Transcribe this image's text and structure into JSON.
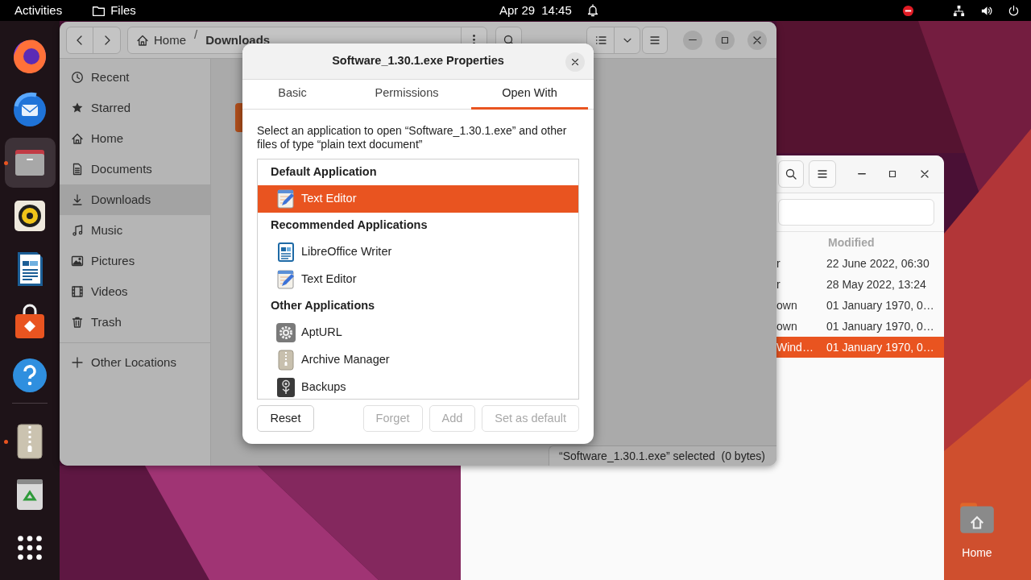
{
  "top_bar": {
    "activities": "Activities",
    "app_menu": "Files",
    "date": "Apr 29",
    "time": "14:45"
  },
  "dock": {
    "pinned": [
      {
        "kind": "browser",
        "focused": false,
        "running": false
      },
      {
        "kind": "mail",
        "focused": false,
        "running": false
      },
      {
        "kind": "files",
        "focused": true,
        "running": true
      },
      {
        "kind": "music-player",
        "focused": false,
        "running": false
      },
      {
        "kind": "writer",
        "focused": false,
        "running": false
      },
      {
        "kind": "software",
        "focused": false,
        "running": false
      },
      {
        "kind": "help",
        "focused": false,
        "running": false
      }
    ],
    "extra": [
      {
        "kind": "archive",
        "focused": false,
        "running": true
      },
      {
        "kind": "trash",
        "focused": false,
        "running": false
      }
    ]
  },
  "background_window": {
    "modified_heading": "Modified",
    "rows": [
      {
        "column_1": "r",
        "modified": "22 June 2022, 06:30",
        "selected": false
      },
      {
        "column_1": "r",
        "modified": "28 May 2022, 13:24",
        "selected": false
      },
      {
        "column_1": "own",
        "modified": "01 January 1970, 0…",
        "selected": false
      },
      {
        "column_1": "own",
        "modified": "01 January 1970, 0…",
        "selected": false
      },
      {
        "column_1": "Wind…",
        "modified": "01 January 1970, 0…",
        "selected": true
      }
    ]
  },
  "desktop_icons": [
    {
      "label": "Home"
    }
  ],
  "files_window": {
    "path": {
      "crumbs": [
        "Home",
        "Downloads"
      ],
      "separator": "/"
    },
    "sidebar": {
      "items": [
        {
          "label": "Recent",
          "kind": "recent",
          "selected": false
        },
        {
          "label": "Starred",
          "kind": "starred",
          "selected": false
        },
        {
          "label": "Home",
          "kind": "home",
          "selected": false
        },
        {
          "label": "Documents",
          "kind": "documents",
          "selected": false
        },
        {
          "label": "Downloads",
          "kind": "downloads",
          "selected": true
        },
        {
          "label": "Music",
          "kind": "music",
          "selected": false
        },
        {
          "label": "Pictures",
          "kind": "pictures",
          "selected": false
        },
        {
          "label": "Videos",
          "kind": "videos",
          "selected": false
        },
        {
          "label": "Trash",
          "kind": "trash",
          "selected": false
        }
      ],
      "other_locations": "Other Locations"
    },
    "status_bar": "“Software_1.30.1.exe” selected  (0 bytes)"
  },
  "properties_dialog": {
    "title": "Software_1.30.1.exe Properties",
    "tabs": [
      {
        "label": "Basic",
        "selected": false
      },
      {
        "label": "Permissions",
        "selected": false
      },
      {
        "label": "Open With",
        "selected": true
      }
    ],
    "description": "Select an application to open “Software_1.30.1.exe” and other files of type “plain text document”",
    "sections": [
      {
        "heading": "Default Application",
        "apps": [
          {
            "name": "Text Editor",
            "kind": "text-editor",
            "selected": true
          }
        ]
      },
      {
        "heading": "Recommended Applications",
        "apps": [
          {
            "name": "LibreOffice Writer",
            "kind": "writer",
            "selected": false
          },
          {
            "name": "Text Editor",
            "kind": "text-editor",
            "selected": false
          }
        ]
      },
      {
        "heading": "Other Applications",
        "apps": [
          {
            "name": "AptURL",
            "kind": "apturl",
            "selected": false
          },
          {
            "name": "Archive Manager",
            "kind": "archive",
            "selected": false
          },
          {
            "name": "Backups",
            "kind": "backups",
            "selected": false
          }
        ]
      }
    ],
    "buttons": [
      {
        "label": "Reset",
        "disabled": false
      },
      {
        "label": "Forget",
        "disabled": true
      },
      {
        "label": "Add",
        "disabled": true
      },
      {
        "label": "Set as default",
        "disabled": true
      }
    ]
  }
}
